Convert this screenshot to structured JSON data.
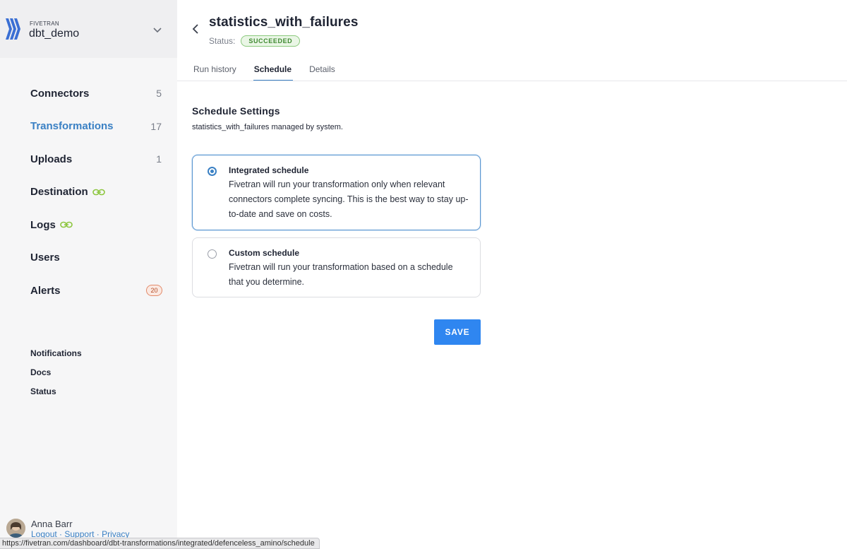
{
  "account": {
    "brand": "FIVETRAN",
    "name": "dbt_demo"
  },
  "nav": {
    "items": [
      {
        "label": "Connectors",
        "count": "5"
      },
      {
        "label": "Transformations",
        "count": "17"
      },
      {
        "label": "Uploads",
        "count": "1"
      },
      {
        "label": "Destination"
      },
      {
        "label": "Logs"
      },
      {
        "label": "Users"
      },
      {
        "label": "Alerts",
        "badge": "20"
      }
    ]
  },
  "secondary_nav": [
    "Notifications",
    "Docs",
    "Status"
  ],
  "user": {
    "name": "Anna Barr",
    "links": [
      "Logout",
      "Support",
      "Privacy"
    ],
    "separator": " · "
  },
  "page": {
    "title": "statistics_with_failures",
    "status_label": "Status:",
    "status_value": "SUCCEEDED"
  },
  "tabs": [
    {
      "label": "Run history"
    },
    {
      "label": "Schedule",
      "active": true
    },
    {
      "label": "Details"
    }
  ],
  "schedule": {
    "title": "Schedule Settings",
    "subtitle": "statistics_with_failures managed by system.",
    "options": [
      {
        "title": "Integrated schedule",
        "description": "Fivetran will run your transformation only when relevant connectors complete syncing. This is the best way to stay up-to-date and save on costs.",
        "selected": true
      },
      {
        "title": "Custom schedule",
        "description": "Fivetran will run your transformation based on a schedule that you determine.",
        "selected": false
      }
    ],
    "save_label": "SAVE"
  },
  "statusbar": {
    "url": "https://fivetran.com/dashboard/dbt-transformations/integrated/defenceless_amino/schedule"
  },
  "colors": {
    "accent": "#3a80c4",
    "save_button": "#2f86f0",
    "success_text": "#3e8a30",
    "alert_badge": "#e28a6a",
    "link_icon": "#8dc63f"
  },
  "icons": {
    "logo": "fivetran-logo-icon",
    "account_menu": "chevron-down-icon",
    "back": "chevron-left-icon",
    "destination": "link-icon",
    "logs": "link-icon"
  }
}
